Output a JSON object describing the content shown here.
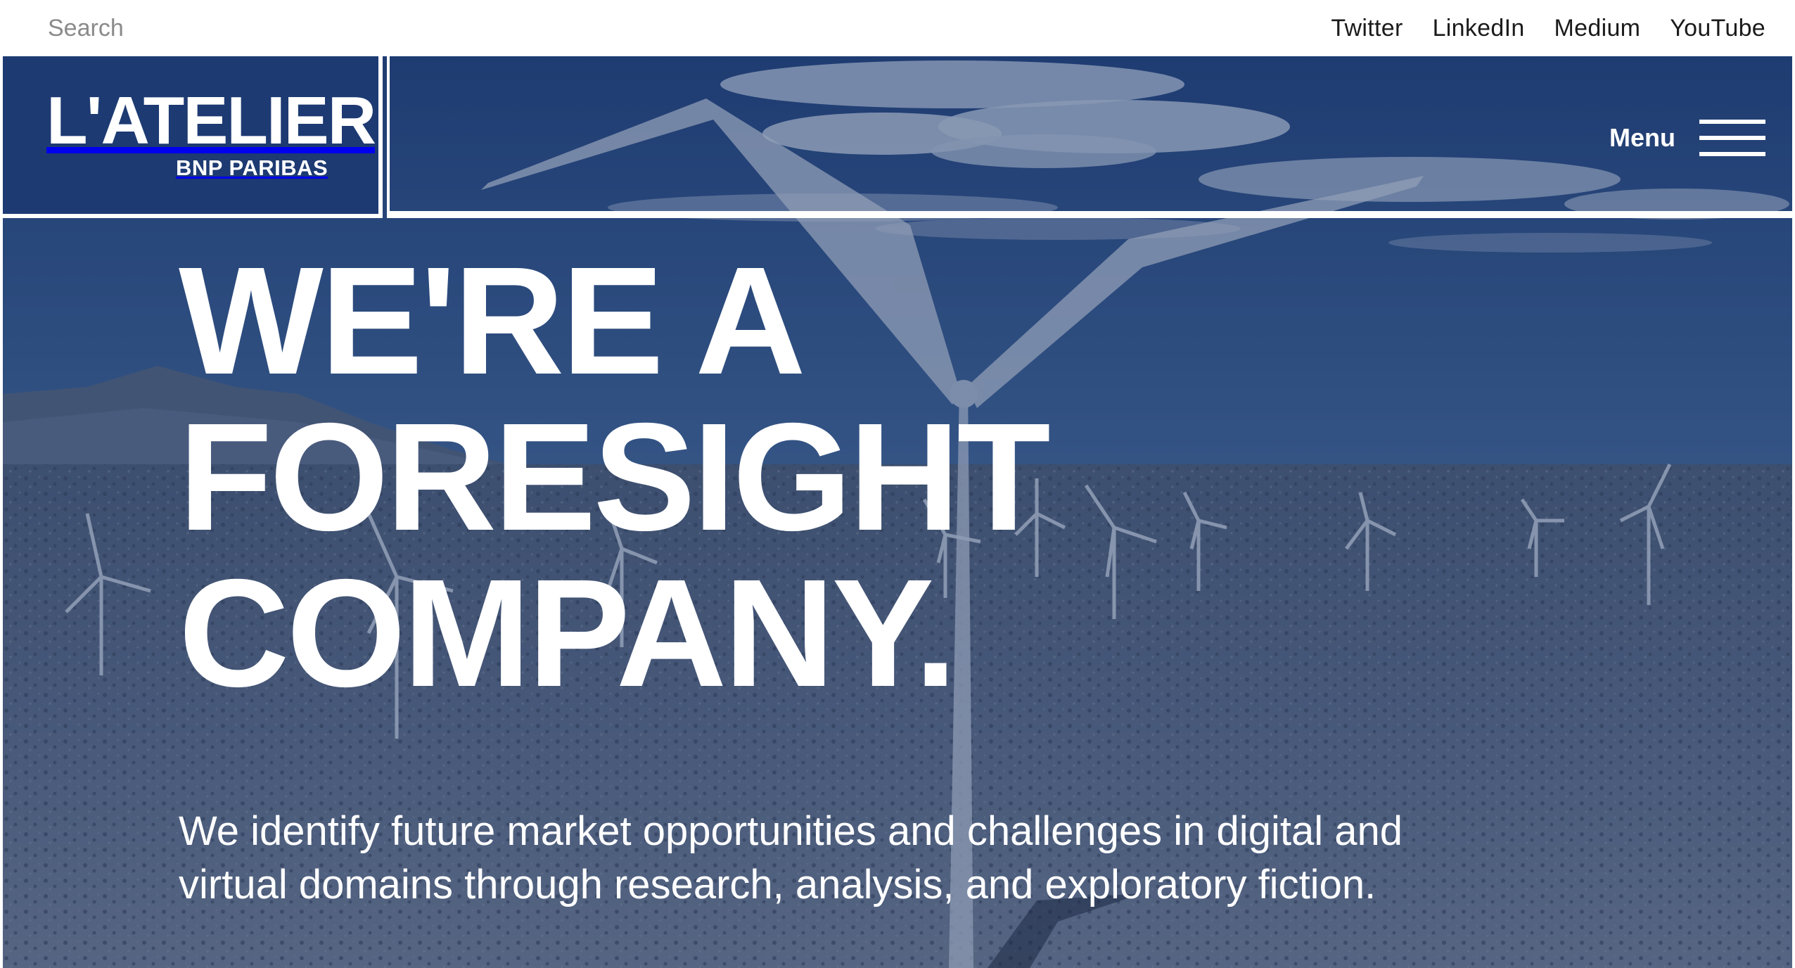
{
  "topbar": {
    "search_placeholder": "Search",
    "social_links": [
      {
        "label": "Twitter"
      },
      {
        "label": "LinkedIn"
      },
      {
        "label": "Medium"
      },
      {
        "label": "YouTube"
      }
    ]
  },
  "header": {
    "logo_main": "L'ATELIER",
    "logo_sub": "BNP PARIBAS",
    "menu_label": "Menu",
    "menu_icon": "hamburger-icon"
  },
  "hero": {
    "headline_lines": [
      "WE'RE A",
      "FORESIGHT",
      "COMPANY."
    ],
    "subtext": "We identify future market opportunities and challenges in digital and virtual domains through research, analysis, and exploratory fiction.",
    "background_image": "wind-farm-landscape"
  },
  "colors": {
    "brand_blue": "#1d3a72",
    "text_white": "#ffffff",
    "topbar_text": "#1b1b1b"
  }
}
